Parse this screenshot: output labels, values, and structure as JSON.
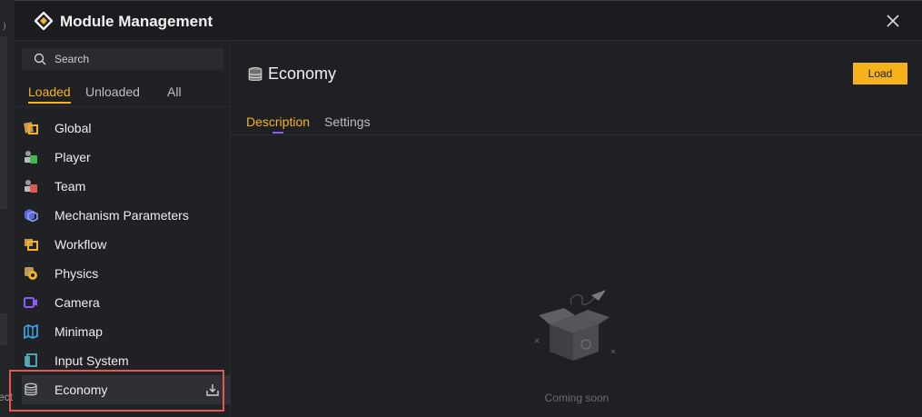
{
  "background": {
    "left_text": ")",
    "left_text_bottom": "ect"
  },
  "dialog": {
    "title": "Module Management",
    "logo_icon": "module-logo-icon",
    "close_icon": "close-icon"
  },
  "sidebar": {
    "search_placeholder": "Search",
    "tabs": [
      {
        "label": "Loaded",
        "active": true
      },
      {
        "label": "Unloaded",
        "active": false
      },
      {
        "label": "All",
        "active": false
      }
    ],
    "items": [
      {
        "label": "Global",
        "icon": "global-icon"
      },
      {
        "label": "Player",
        "icon": "player-icon"
      },
      {
        "label": "Team",
        "icon": "team-icon"
      },
      {
        "label": "Mechanism Parameters",
        "icon": "mechanism-icon"
      },
      {
        "label": "Workflow",
        "icon": "workflow-icon"
      },
      {
        "label": "Physics",
        "icon": "physics-icon"
      },
      {
        "label": "Camera",
        "icon": "camera-icon"
      },
      {
        "label": "Minimap",
        "icon": "minimap-icon"
      },
      {
        "label": "Input System",
        "icon": "input-system-icon"
      },
      {
        "label": "Economy",
        "icon": "economy-icon",
        "selected": true
      }
    ]
  },
  "content": {
    "title": "Economy",
    "load_label": "Load",
    "tabs": [
      {
        "label": "Description",
        "active": true
      },
      {
        "label": "Settings",
        "active": false
      }
    ],
    "empty_text": "Coming soon"
  },
  "colors": {
    "accent": "#f5b324",
    "tab_underline": "#8b5cf6",
    "highlight": "#e05a55"
  }
}
